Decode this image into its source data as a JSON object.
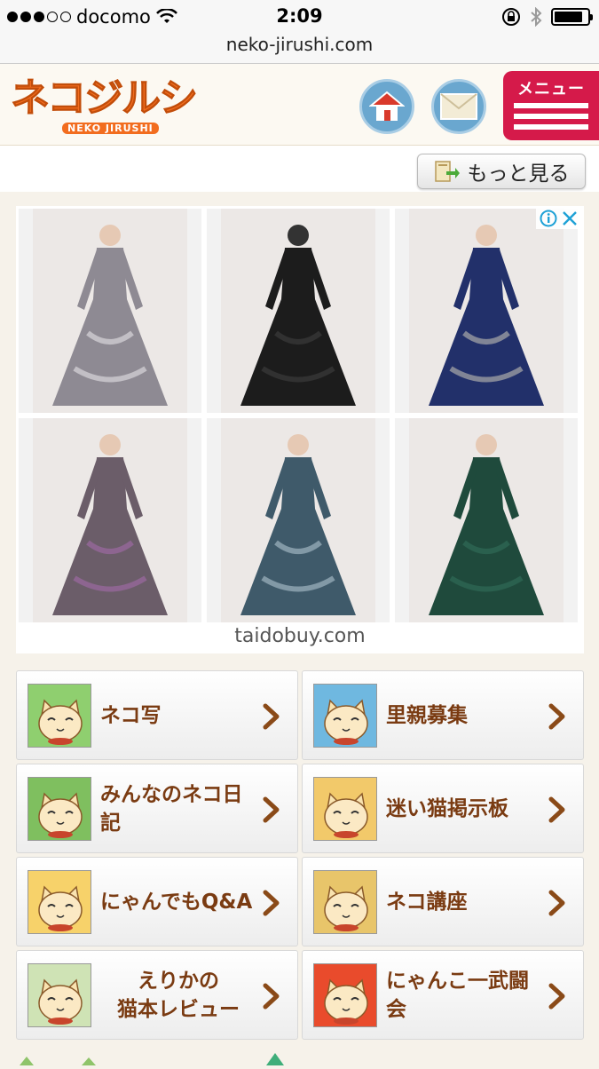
{
  "status": {
    "carrier": "docomo",
    "time": "2:09",
    "signal_bars_filled": 3,
    "signal_bars_total": 5,
    "battery_level": 0.85
  },
  "url": "neko-jirushi.com",
  "header": {
    "logo_text": "ネコジルシ",
    "logo_sub": "NEKO JIRUSHI",
    "home_icon": "home-icon",
    "mail_icon": "mail-icon",
    "menu_label": "メニュー"
  },
  "more_button": {
    "label": "もっと見る"
  },
  "ad": {
    "domain": "taidobuy.com",
    "tiles": [
      {
        "color": "#8e8a93",
        "accent": "#d9d6da"
      },
      {
        "color": "#1c1c1c",
        "accent": "#3a3a3a"
      },
      {
        "color": "#22306a",
        "accent": "#a9a9a9"
      },
      {
        "color": "#6b5d69",
        "accent": "#9b6aa1"
      },
      {
        "color": "#3f5a6a",
        "accent": "#9fb3c0"
      },
      {
        "color": "#1f4a3c",
        "accent": "#2f6a55"
      }
    ]
  },
  "nav": [
    {
      "label": "ネコ写",
      "icon_bg": "#8fcf6f"
    },
    {
      "label": "里親募集",
      "icon_bg": "#6fb8e0"
    },
    {
      "label": "みんなのネコ日記",
      "icon_bg": "#7fbf5f"
    },
    {
      "label": "迷い猫掲示板",
      "icon_bg": "#f2c96a"
    },
    {
      "label": "にゃんでもQ&A",
      "icon_bg": "#f7d26a"
    },
    {
      "label": "ネコ講座",
      "icon_bg": "#e8c56a"
    },
    {
      "label": "えりかの\n猫本レビュー",
      "icon_bg": "#cfe3b5"
    },
    {
      "label": "にゃんこ一武闘会",
      "icon_bg": "#e94b2c"
    }
  ]
}
